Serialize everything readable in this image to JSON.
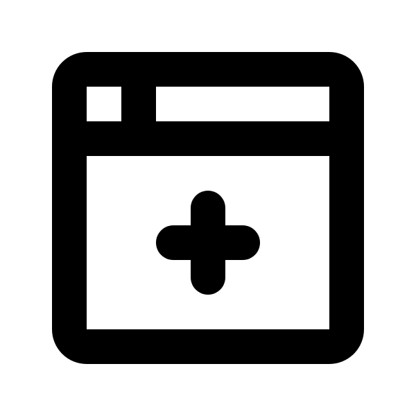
{
  "icon": {
    "name": "browser-window-add-icon",
    "stroke_color": "#000000",
    "background_color": "#ffffff"
  }
}
